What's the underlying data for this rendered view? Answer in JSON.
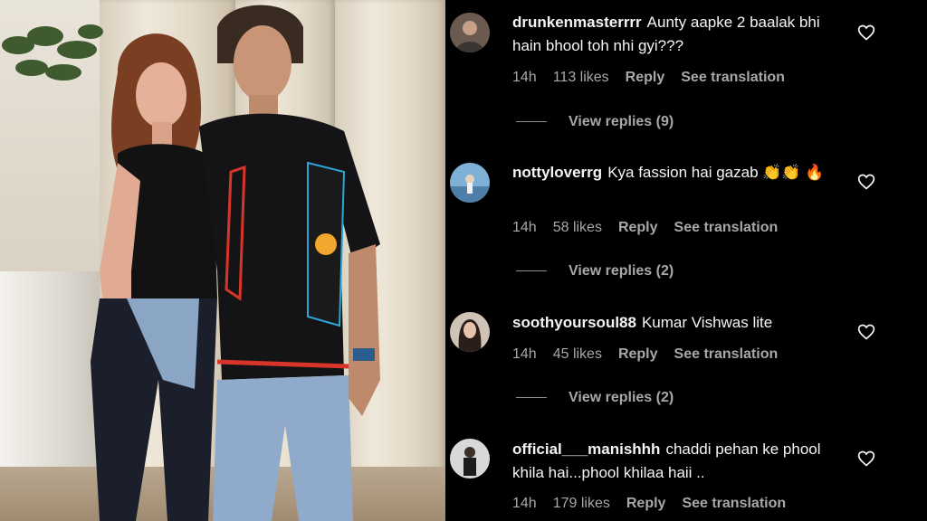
{
  "photo": {
    "alt": "Two people posing together"
  },
  "comments": [
    {
      "username": "drunkenmasterrrr",
      "text": "Aunty aapke 2 baalak bhi hain bhool toh nhi gyi???",
      "time": "14h",
      "likes": "113 likes",
      "reply": "Reply",
      "translate": "See translation",
      "view_replies": "View replies (9)"
    },
    {
      "username": "nottyloverrg",
      "text": "Kya fassion hai gazab 👏👏 🔥",
      "time": "14h",
      "likes": "58 likes",
      "reply": "Reply",
      "translate": "See translation",
      "view_replies": "View replies (2)"
    },
    {
      "username": "soothyoursoul88",
      "text": "Kumar Vishwas lite",
      "time": "14h",
      "likes": "45 likes",
      "reply": "Reply",
      "translate": "See translation",
      "view_replies": "View replies (2)"
    },
    {
      "username": "official___manishhh",
      "text": "chaddi pehan ke phool khila hai...phool khilaa haii ..",
      "time": "14h",
      "likes": "179 likes",
      "reply": "Reply",
      "translate": "See translation"
    }
  ],
  "colors": {
    "background": "#000000",
    "text": "#f5f5f5",
    "muted": "#a8a8a8"
  }
}
